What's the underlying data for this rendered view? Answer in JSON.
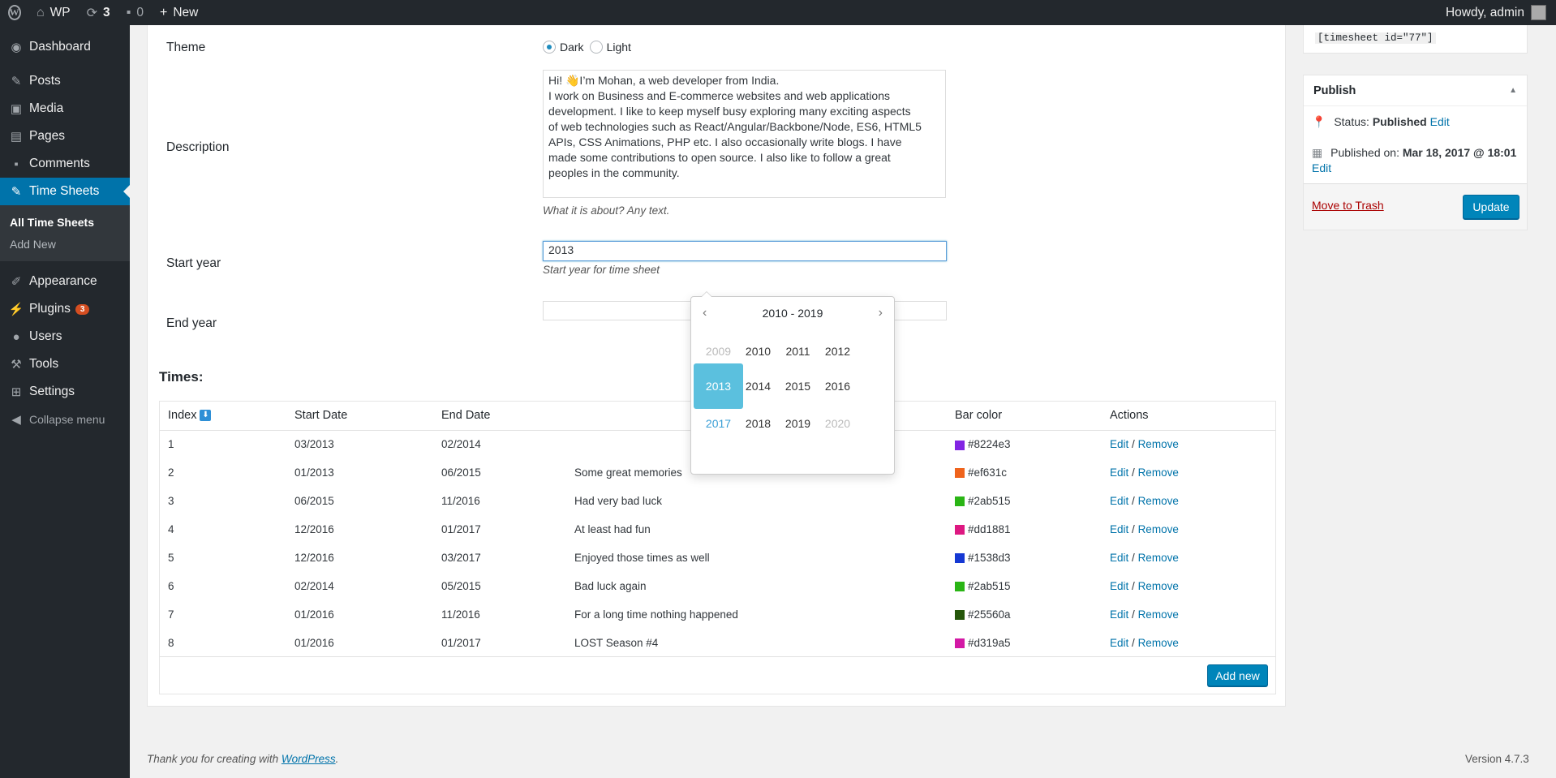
{
  "adminbar": {
    "site_name": "WP",
    "updates_count": "3",
    "comments_count": "0",
    "new_label": "New",
    "howdy": "Howdy, admin"
  },
  "sidebar": {
    "items": [
      {
        "label": "Dashboard",
        "icon": "dashboard-icon"
      },
      {
        "label": "Posts",
        "icon": "pin-icon"
      },
      {
        "label": "Media",
        "icon": "media-icon"
      },
      {
        "label": "Pages",
        "icon": "pages-icon"
      },
      {
        "label": "Comments",
        "icon": "comment-icon"
      },
      {
        "label": "Time Sheets",
        "icon": "pin-icon",
        "current": true
      },
      {
        "label": "Appearance",
        "icon": "brush-icon"
      },
      {
        "label": "Plugins",
        "icon": "plugin-icon",
        "badge": "3"
      },
      {
        "label": "Users",
        "icon": "users-icon"
      },
      {
        "label": "Tools",
        "icon": "wrench-icon"
      },
      {
        "label": "Settings",
        "icon": "settings-icon"
      }
    ],
    "submenu": [
      "All Time Sheets",
      "Add New"
    ],
    "collapse_label": "Collapse menu"
  },
  "form": {
    "theme_label": "Theme",
    "theme_options": [
      "Dark",
      "Light"
    ],
    "theme_selected": "Dark",
    "description_label": "Description",
    "description_lines": [
      "Hi! 👋I’m Mohan, a web developer from India.",
      "I work on Business and E-commerce websites and web applications",
      "development. I like to keep myself busy exploring many exciting aspects",
      "of web technologies such as React/Angular/Backbone/Node, ES6, HTML5",
      "APIs, CSS Animations, PHP etc. I also occasionally write blogs. I have",
      "made some contributions to open source. I also like to follow a great",
      "peoples in the community."
    ],
    "description_hint": "What it is about? Any text.",
    "start_year_label": "Start year",
    "start_year_value": "2013",
    "start_year_hint": "Start year for time sheet",
    "end_year_label": "End year",
    "end_year_value": ""
  },
  "datepicker": {
    "range": "2010 - 2019",
    "years": [
      "2009",
      "2010",
      "2011",
      "2012",
      "2013",
      "2014",
      "2015",
      "2016",
      "2017",
      "2018",
      "2019",
      "2020"
    ],
    "selected": "2013",
    "current": "2017",
    "muted": [
      "2009",
      "2020"
    ]
  },
  "times": {
    "title": "Times:",
    "columns": [
      "Index",
      "Start Date",
      "End Date",
      "",
      "Bar color",
      "Actions"
    ],
    "rows": [
      {
        "index": "1",
        "start": "03/2013",
        "end": "02/2014",
        "text": "",
        "color": "#8224e3"
      },
      {
        "index": "2",
        "start": "01/2013",
        "end": "06/2015",
        "text": "Some great memories",
        "color": "#ef631c"
      },
      {
        "index": "3",
        "start": "06/2015",
        "end": "11/2016",
        "text": "Had very bad luck",
        "color": "#2ab515"
      },
      {
        "index": "4",
        "start": "12/2016",
        "end": "01/2017",
        "text": "At least had fun",
        "color": "#dd1881"
      },
      {
        "index": "5",
        "start": "12/2016",
        "end": "03/2017",
        "text": "Enjoyed those times as well",
        "color": "#1538d3"
      },
      {
        "index": "6",
        "start": "02/2014",
        "end": "05/2015",
        "text": "Bad luck again",
        "color": "#2ab515"
      },
      {
        "index": "7",
        "start": "01/2016",
        "end": "11/2016",
        "text": "For a long time nothing happened",
        "color": "#25560a"
      },
      {
        "index": "8",
        "start": "01/2016",
        "end": "01/2017",
        "text": "LOST Season #4",
        "color": "#d319a5"
      }
    ],
    "edit_label": "Edit",
    "remove_label": "Remove",
    "separator": "/",
    "add_new_label": "Add new"
  },
  "shortcode": "[timesheet id=\"77\"]",
  "publish": {
    "title": "Publish",
    "status_label": "Status:",
    "status_value": "Published",
    "status_edit": "Edit",
    "published_label": "Published on:",
    "published_value": "Mar 18, 2017 @ 18:01",
    "published_edit": "Edit",
    "trash_label": "Move to Trash",
    "update_label": "Update"
  },
  "footer": {
    "thanks_prefix": "Thank you for creating with ",
    "thanks_link": "WordPress",
    "thanks_suffix": ".",
    "version": "Version 4.7.3"
  }
}
